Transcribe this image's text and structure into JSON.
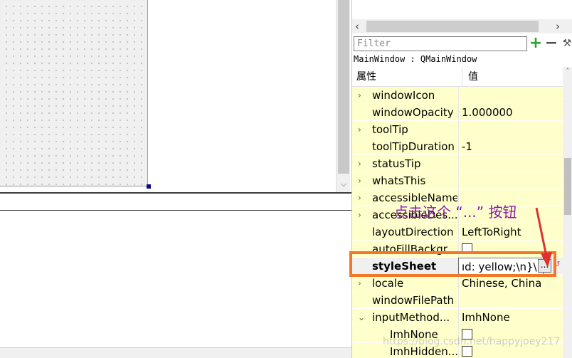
{
  "filter": {
    "placeholder": "Filter"
  },
  "object": {
    "class_label": "MainWindow : QMainWindow"
  },
  "table": {
    "headers": {
      "property": "属性",
      "value": "值"
    },
    "rows": [
      {
        "name": "windowIcon",
        "value": "",
        "expander": "›",
        "type": "text"
      },
      {
        "name": "windowOpacity",
        "value": "1.000000",
        "expander": "",
        "type": "text"
      },
      {
        "name": "toolTip",
        "value": "",
        "expander": "›",
        "type": "text"
      },
      {
        "name": "toolTipDuration",
        "value": "-1",
        "expander": "",
        "type": "text"
      },
      {
        "name": "statusTip",
        "value": "",
        "expander": "›",
        "type": "text"
      },
      {
        "name": "whatsThis",
        "value": "",
        "expander": "›",
        "type": "text"
      },
      {
        "name": "accessibleName",
        "value": "",
        "expander": "›",
        "type": "text"
      },
      {
        "name": "accessibleDes...",
        "value": "",
        "expander": "›",
        "type": "text"
      },
      {
        "name": "layoutDirection",
        "value": "LeftToRight",
        "expander": "",
        "type": "text"
      },
      {
        "name": "autoFillBackgr...",
        "value": "",
        "expander": "",
        "type": "checkbox"
      },
      {
        "name": "styleSheet",
        "value": "ıd: yellow;\\n}\\n",
        "expander": "",
        "type": "selected"
      },
      {
        "name": "locale",
        "value": "Chinese, China",
        "expander": "›",
        "type": "text"
      },
      {
        "name": "windowFilePath",
        "value": "",
        "expander": "",
        "type": "text"
      },
      {
        "name": "inputMethod...",
        "value": "ImhNone",
        "expander": "⌄",
        "type": "text"
      },
      {
        "name": "ImhNone",
        "value": "",
        "expander": "",
        "type": "child-checkbox"
      },
      {
        "name": "ImhHidden...",
        "value": "",
        "expander": "",
        "type": "child-checkbox"
      }
    ]
  },
  "stylesheet_button_label": "...",
  "annotation": {
    "text": "点击这个 “...” 按钮"
  },
  "watermark": "https://blog.csdn.net/happyjoey217",
  "colors": {
    "highlight": "#f07828",
    "annotation": "#8b1aa8",
    "row_bg": "#ffffcc"
  }
}
